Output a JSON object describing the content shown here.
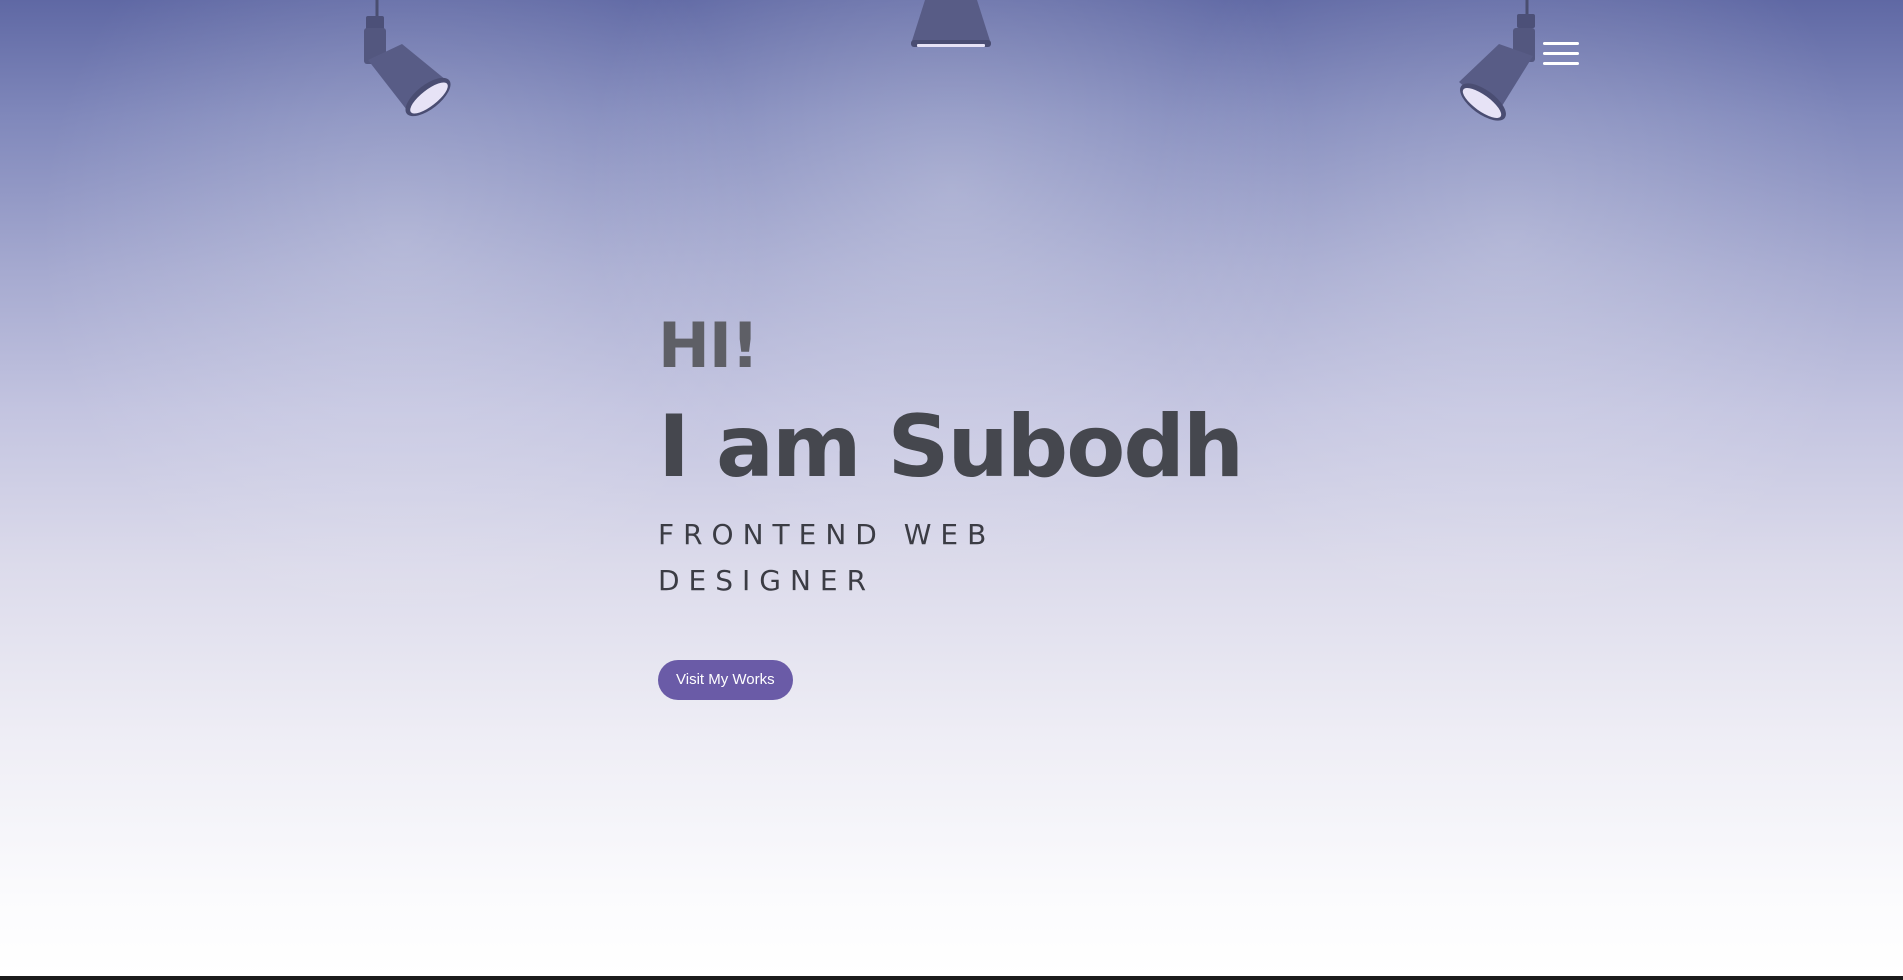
{
  "hero": {
    "greeting": "HI!",
    "name": "I am Subodh",
    "role_line1": "FRONTEND WEB",
    "role_line2": "DESIGNER",
    "cta_label": "Visit My Works"
  },
  "icons": {
    "menu": "hamburger-menu-icon",
    "lamps": [
      "spotlight-left-icon",
      "spotlight-center-icon",
      "spotlight-right-icon"
    ]
  },
  "colors": {
    "accent": "#6a5ba7",
    "heading": "#45474e",
    "background_top": "#5f68a4",
    "background_bottom": "#ffffff"
  }
}
